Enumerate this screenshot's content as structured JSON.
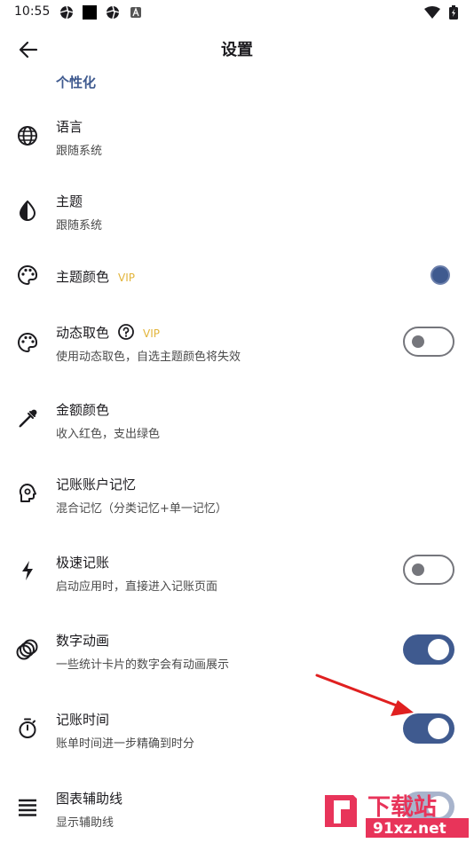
{
  "status_bar": {
    "time": "10:55"
  },
  "app_bar": {
    "title": "设置",
    "back_icon": "arrow-left-icon"
  },
  "section": {
    "header": "个性化"
  },
  "settings": [
    {
      "title": "语言",
      "subtitle": "跟随系统",
      "icon": "globe-icon"
    },
    {
      "title": "主题",
      "subtitle": "跟随系统",
      "icon": "contrast-drop-icon"
    },
    {
      "title": "主题颜色",
      "badge": "VIP",
      "icon": "palette-icon",
      "accessory": "color-swatch",
      "accent_color": "#3f5a8f"
    },
    {
      "title": "动态取色",
      "badge": "VIP",
      "subtitle": "使用动态取色，自选主题颜色将失效",
      "icon": "palette-icon",
      "help_icon": "question-circle-icon",
      "toggle": false
    },
    {
      "title": "金额颜色",
      "subtitle": "收入红色，支出绿色",
      "icon": "eyedropper-icon"
    },
    {
      "title": "记账账户记忆",
      "subtitle": "混合记忆（分类记忆+单一记忆）",
      "icon": "head-memory-icon"
    },
    {
      "title": "极速记账",
      "subtitle": "启动应用时，直接进入记账页面",
      "icon": "lightning-icon",
      "toggle": false
    },
    {
      "title": "数字动画",
      "subtitle": "一些统计卡片的数字会有动画展示",
      "icon": "animation-rings-icon",
      "toggle": true
    },
    {
      "title": "记账时间",
      "subtitle": "账单时间进一步精确到时分",
      "icon": "timer-icon",
      "toggle": true
    },
    {
      "title": "图表辅助线",
      "subtitle": "显示辅助线",
      "icon": "lines-icon"
    }
  ],
  "watermark": {
    "brand": "下载站",
    "site": "91xz.net"
  }
}
